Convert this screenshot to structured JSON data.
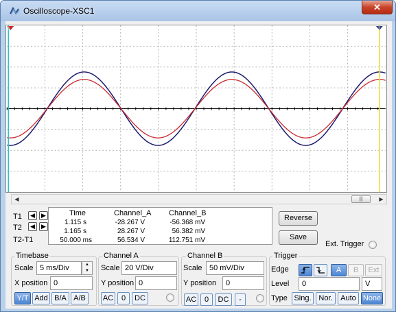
{
  "window": {
    "title": "Oscilloscope-XSC1",
    "close_label": "✕"
  },
  "readout": {
    "headers": [
      "Time",
      "Channel_A",
      "Channel_B"
    ],
    "rows": [
      {
        "name": "T1",
        "time": "1.115 s",
        "a": "-28.267 V",
        "b": "-56.368 mV"
      },
      {
        "name": "T2",
        "time": "1.165 s",
        "a": "28.267 V",
        "b": "56.382 mV"
      },
      {
        "name": "T2-T1",
        "time": "50.000 ms",
        "a": "56.534 V",
        "b": "112.751 mV"
      }
    ]
  },
  "buttons": {
    "reverse": "Reverse",
    "save": "Save",
    "ext_trigger": "Ext. Trigger"
  },
  "timebase": {
    "title": "Timebase",
    "scale_label": "Scale",
    "scale_value": "5 ms/Div",
    "xpos_label": "X position",
    "xpos_value": "0",
    "modes": [
      "Y/T",
      "Add",
      "B/A",
      "A/B"
    ]
  },
  "channel_a": {
    "title": "Channel A",
    "scale_label": "Scale",
    "scale_value": "20  V/Div",
    "ypos_label": "Y position",
    "ypos_value": "0",
    "coupling": [
      "AC",
      "0",
      "DC"
    ]
  },
  "channel_b": {
    "title": "Channel B",
    "scale_label": "Scale",
    "scale_value": "50 mV/Div",
    "ypos_label": "Y position",
    "ypos_value": "0",
    "coupling": [
      "AC",
      "0",
      "DC",
      "-"
    ]
  },
  "trigger": {
    "title": "Trigger",
    "edge_label": "Edge",
    "level_label": "Level",
    "level_value": "0",
    "level_unit": "V",
    "type_label": "Type",
    "sources": [
      "A",
      "B",
      "Ext"
    ],
    "types": [
      "Sing.",
      "Nor.",
      "Auto",
      "None"
    ]
  },
  "colors": {
    "channel_a": "#1a1a6e",
    "channel_b": "#c8282d",
    "cursor1": "#27c5c5",
    "cursor2": "#e8e020",
    "grid": "#b0b0b0"
  }
}
